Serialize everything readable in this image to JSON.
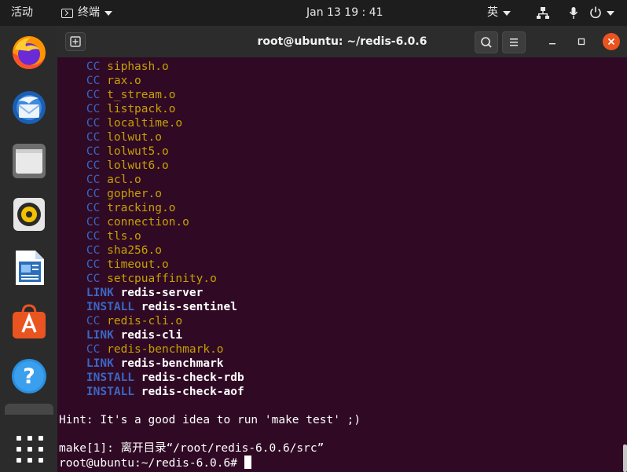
{
  "topbar": {
    "activities": "活动",
    "app_name": "终端",
    "clock": "Jan 13  19 : 41",
    "input_method": "英"
  },
  "window": {
    "title": "root@ubuntu: ~/redis-6.0.6"
  },
  "build_lines": [
    {
      "kind": "CC",
      "target": "siphash.o"
    },
    {
      "kind": "CC",
      "target": "rax.o"
    },
    {
      "kind": "CC",
      "target": "t_stream.o"
    },
    {
      "kind": "CC",
      "target": "listpack.o"
    },
    {
      "kind": "CC",
      "target": "localtime.o"
    },
    {
      "kind": "CC",
      "target": "lolwut.o"
    },
    {
      "kind": "CC",
      "target": "lolwut5.o"
    },
    {
      "kind": "CC",
      "target": "lolwut6.o"
    },
    {
      "kind": "CC",
      "target": "acl.o"
    },
    {
      "kind": "CC",
      "target": "gopher.o"
    },
    {
      "kind": "CC",
      "target": "tracking.o"
    },
    {
      "kind": "CC",
      "target": "connection.o"
    },
    {
      "kind": "CC",
      "target": "tls.o"
    },
    {
      "kind": "CC",
      "target": "sha256.o"
    },
    {
      "kind": "CC",
      "target": "timeout.o"
    },
    {
      "kind": "CC",
      "target": "setcpuaffinity.o"
    },
    {
      "kind": "LINK",
      "target": "redis-server"
    },
    {
      "kind": "INSTALL",
      "target": "redis-sentinel"
    },
    {
      "kind": "CC",
      "target": "redis-cli.o"
    },
    {
      "kind": "LINK",
      "target": "redis-cli"
    },
    {
      "kind": "CC",
      "target": "redis-benchmark.o"
    },
    {
      "kind": "LINK",
      "target": "redis-benchmark"
    },
    {
      "kind": "INSTALL",
      "target": "redis-check-rdb"
    },
    {
      "kind": "INSTALL",
      "target": "redis-check-aof"
    }
  ],
  "terminal": {
    "hint": "Hint: It's a good idea to run 'make test' ;)",
    "make_leave": "make[1]: 离开目录“/root/redis-6.0.6/src”",
    "prompt": "root@ubuntu:~/redis-6.0.6# "
  },
  "dock": {
    "apps": [
      "firefox-icon",
      "thunderbird-icon",
      "files-icon",
      "rhythmbox-icon",
      "libreoffice-writer-icon",
      "ubuntu-software-icon",
      "help-icon",
      "show-applications-icon"
    ]
  },
  "colors": {
    "terminal_bg": "#300a24",
    "keyword_blue": "#3b66c4",
    "object_yellow": "#c5a000",
    "close_orange": "#e95420"
  }
}
